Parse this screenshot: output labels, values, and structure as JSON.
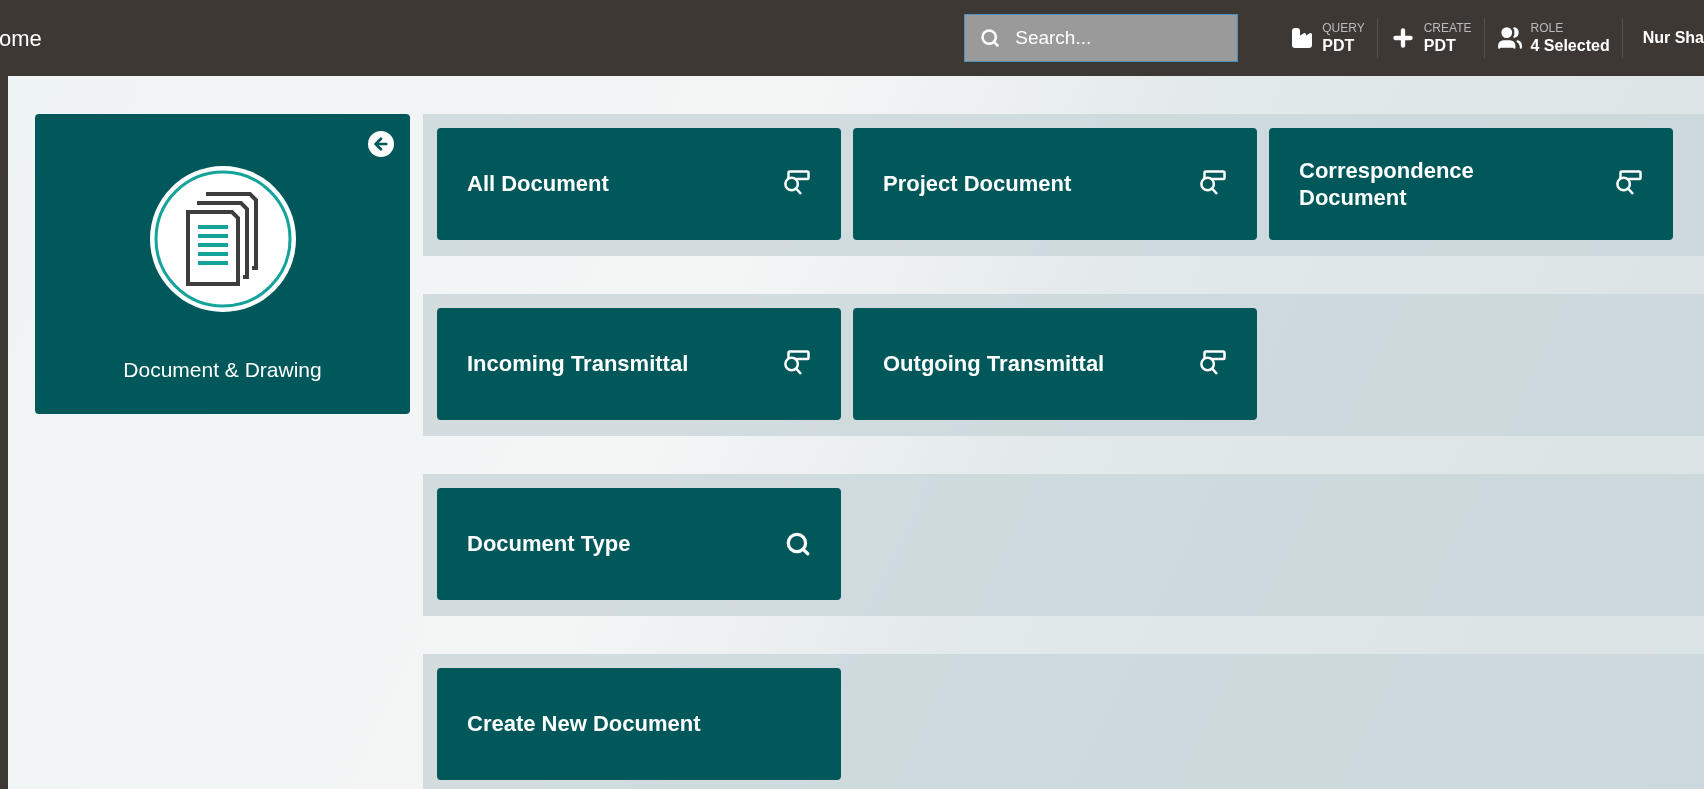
{
  "header": {
    "title": "ome",
    "search": {
      "placeholder": "Search..."
    },
    "actions": [
      {
        "kind": "query",
        "label": "QUERY",
        "value": "PDT"
      },
      {
        "kind": "create",
        "label": "CREATE",
        "value": "PDT"
      },
      {
        "kind": "role",
        "label": "ROLE",
        "value": "4 Selected"
      }
    ],
    "user": "Nur Sha"
  },
  "module": {
    "title": "Document & Drawing"
  },
  "rows": [
    {
      "tiles": [
        {
          "label": "All Document",
          "kind": "query"
        },
        {
          "label": "Project Document",
          "kind": "query"
        },
        {
          "label": "Correspondence Document",
          "kind": "query"
        }
      ]
    },
    {
      "tiles": [
        {
          "label": "Incoming Transmittal",
          "kind": "query"
        },
        {
          "label": "Outgoing Transmittal",
          "kind": "query"
        }
      ]
    },
    {
      "tiles": [
        {
          "label": "Document Type",
          "kind": "search"
        }
      ]
    },
    {
      "tiles": [
        {
          "label": "Create New Document",
          "kind": "plain"
        }
      ]
    }
  ]
}
